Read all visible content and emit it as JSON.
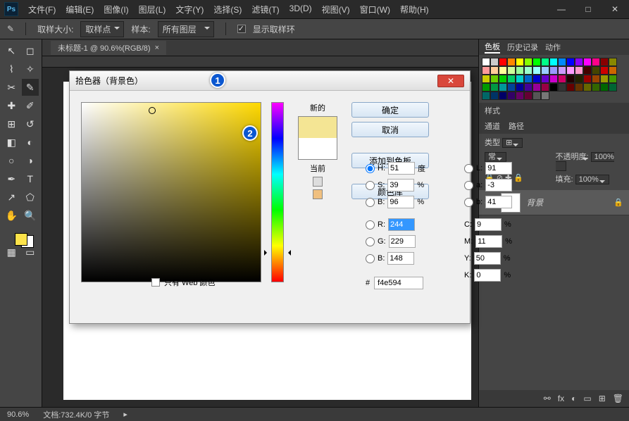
{
  "menu": {
    "file": "文件(F)",
    "edit": "编辑(E)",
    "image": "图像(I)",
    "layer": "图层(L)",
    "type": "文字(Y)",
    "select": "选择(S)",
    "filter": "滤镜(T)",
    "threeD": "3D(D)",
    "view": "视图(V)",
    "window": "窗口(W)",
    "help": "帮助(H)"
  },
  "options": {
    "sample_size_label": "取样大小:",
    "sample_size_value": "取样点",
    "sample_label": "样本:",
    "sample_value": "所有图层",
    "show_ring": "显示取样环"
  },
  "tab": {
    "title": "未标题-1 @ 90.6%(RGB/8)"
  },
  "panels": {
    "color": "色板",
    "history": "历史记录",
    "actions": "动作",
    "styles": "样式",
    "channels": "通道",
    "paths": "路径",
    "kind_label": "类型",
    "normal": "常",
    "opacity_label": "不透明度:",
    "opacity_val": "100%",
    "fill_label": "填充:",
    "fill_val": "100%",
    "layer_bg": "背景"
  },
  "status": {
    "zoom": "90.6%",
    "doc": "文档:732.4K/0 字节"
  },
  "dialog": {
    "title": "拾色器（背景色）",
    "new": "新的",
    "current": "当前",
    "ok": "确定",
    "cancel": "取消",
    "add": "添加到色板",
    "lib": "颜色库",
    "H": "H:",
    "S": "S:",
    "Bv": "B:",
    "R": "R:",
    "G": "G:",
    "Bb": "B:",
    "L": "L:",
    "a": "a:",
    "b": "b:",
    "C": "C:",
    "M": "M:",
    "Y": "Y:",
    "K": "K:",
    "Hv": "51",
    "Sv": "39",
    "Bvv": "96",
    "Rv": "244",
    "Gv": "229",
    "Bbv": "148",
    "Lv": "91",
    "av": "-3",
    "bv": "41",
    "Cv": "9",
    "Mv": "11",
    "Yv": "50",
    "Kv": "0",
    "deg": "度",
    "pct": "%",
    "hex_prefix": "#",
    "hex": "f4e594",
    "web_only": "只有 Web 颜色"
  },
  "callouts": {
    "c1": "1",
    "c2": "2"
  },
  "swatch_colors": [
    "#fff",
    "#ccc",
    "#f00",
    "#f80",
    "#ff0",
    "#8f0",
    "#0f0",
    "#0f8",
    "#0ff",
    "#08f",
    "#00f",
    "#80f",
    "#f0f",
    "#f08",
    "#800",
    "#880",
    "#f99",
    "#fc9",
    "#ff9",
    "#cf9",
    "#9f9",
    "#9fc",
    "#9ff",
    "#9cf",
    "#99f",
    "#c9f",
    "#f9f",
    "#f9c",
    "#400",
    "#440",
    "#c00",
    "#c60",
    "#cc0",
    "#6c0",
    "#0c0",
    "#0c6",
    "#0cc",
    "#06c",
    "#00c",
    "#60c",
    "#c0c",
    "#c06",
    "#200",
    "#220",
    "#900",
    "#940",
    "#990",
    "#490",
    "#090",
    "#094",
    "#099",
    "#049",
    "#009",
    "#409",
    "#909",
    "#904",
    "#000",
    "#333",
    "#600",
    "#630",
    "#660",
    "#360",
    "#060",
    "#063",
    "#066",
    "#036",
    "#006",
    "#306",
    "#606",
    "#603",
    "#555",
    "#777"
  ]
}
